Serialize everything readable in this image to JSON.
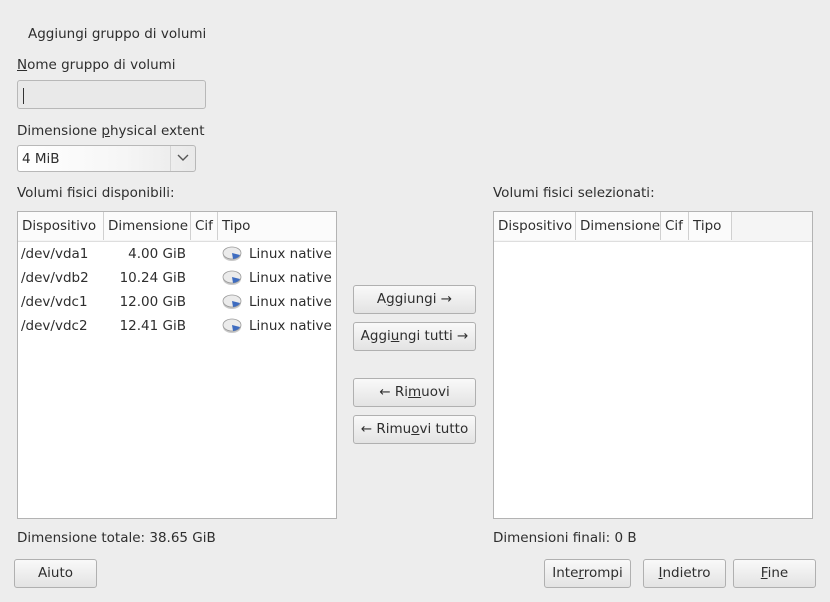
{
  "dialog": {
    "title": "Aggiungi gruppo di volumi"
  },
  "vg_name": {
    "label_mnemonic": "N",
    "label_rest": "ome gruppo di volumi",
    "value": ""
  },
  "extent": {
    "label_pre": "Dimensione ",
    "label_mnemonic": "p",
    "label_post": "hysical extent",
    "value": "4 MiB"
  },
  "available": {
    "title": "Volumi fisici disponibili:",
    "columns": [
      "Dispositivo",
      "Dimensione",
      "Cif",
      "Tipo"
    ],
    "rows": [
      {
        "device": "/dev/vda1",
        "size": "4.00 GiB",
        "cif": "",
        "type": "Linux native",
        "icon": "disk-icon"
      },
      {
        "device": "/dev/vdb2",
        "size": "10.24 GiB",
        "cif": "",
        "type": "Linux native",
        "icon": "disk-icon"
      },
      {
        "device": "/dev/vdc1",
        "size": "12.00 GiB",
        "cif": "",
        "type": "Linux native",
        "icon": "disk-icon"
      },
      {
        "device": "/dev/vdc2",
        "size": "12.41 GiB",
        "cif": "",
        "type": "Linux native",
        "icon": "disk-icon"
      }
    ],
    "total": "Dimensione totale: 38.65 GiB"
  },
  "selected": {
    "title": "Volumi fisici selezionati:",
    "columns": [
      "Dispositivo",
      "Dimensione",
      "Cif",
      "Tipo"
    ],
    "total": "Dimensioni finali: 0 B"
  },
  "actions": {
    "add": {
      "pre": "A",
      "mn": "g",
      "post": "giungi →"
    },
    "add_all": {
      "pre": "Aggi",
      "mn": "u",
      "post": "ngi tutti →"
    },
    "remove": {
      "pre": "← Ri",
      "mn": "m",
      "post": "uovi"
    },
    "remove_all": {
      "pre": "← Rimu",
      "mn": "o",
      "post": "vi tutto"
    }
  },
  "footer": {
    "help": "Aiuto",
    "abort": {
      "pre": "Inte",
      "mn": "r",
      "post": "rompi"
    },
    "back": {
      "pre": "",
      "mn": "I",
      "post": "ndietro"
    },
    "finish": {
      "pre": "",
      "mn": "F",
      "post": "ine"
    }
  }
}
